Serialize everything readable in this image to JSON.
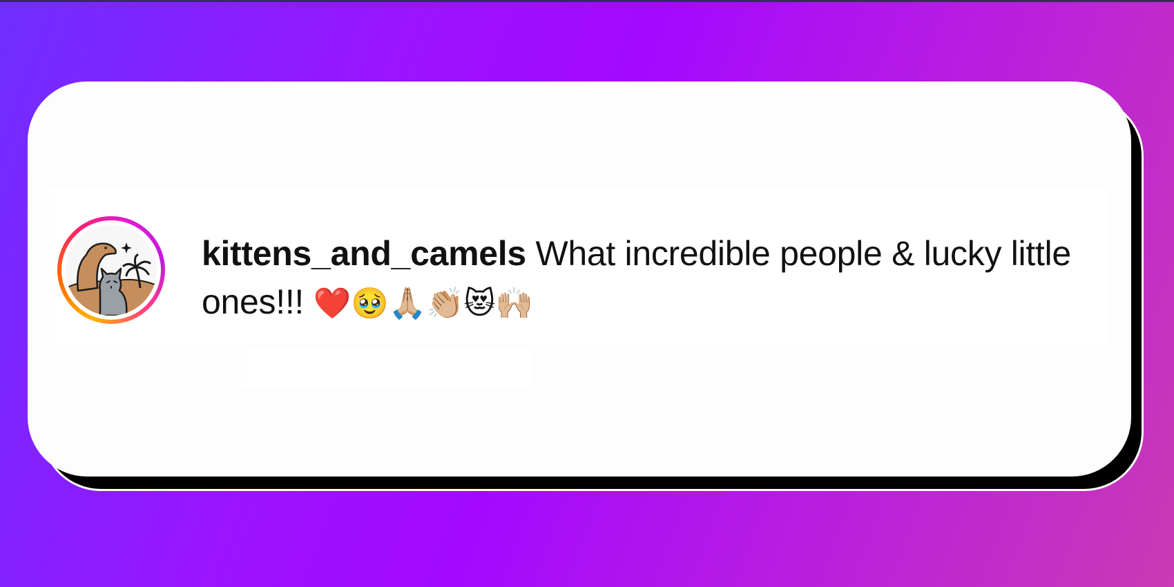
{
  "comment": {
    "username": "kittens_and_camels",
    "text": "What incredible people & lucky little ones!!!",
    "emojis": "❤️🥹🙏🏼👏🏼😻🙌🏼"
  },
  "colors": {
    "background_start": "#6e2eff",
    "background_end": "#c93ab4",
    "card": "#fdfdfd",
    "text": "#111111",
    "avatar_ring": [
      "#ffb300",
      "#ff1f6b",
      "#c41ae0"
    ]
  },
  "icons": {
    "avatar": "camel-and-cat-avatar-icon"
  }
}
